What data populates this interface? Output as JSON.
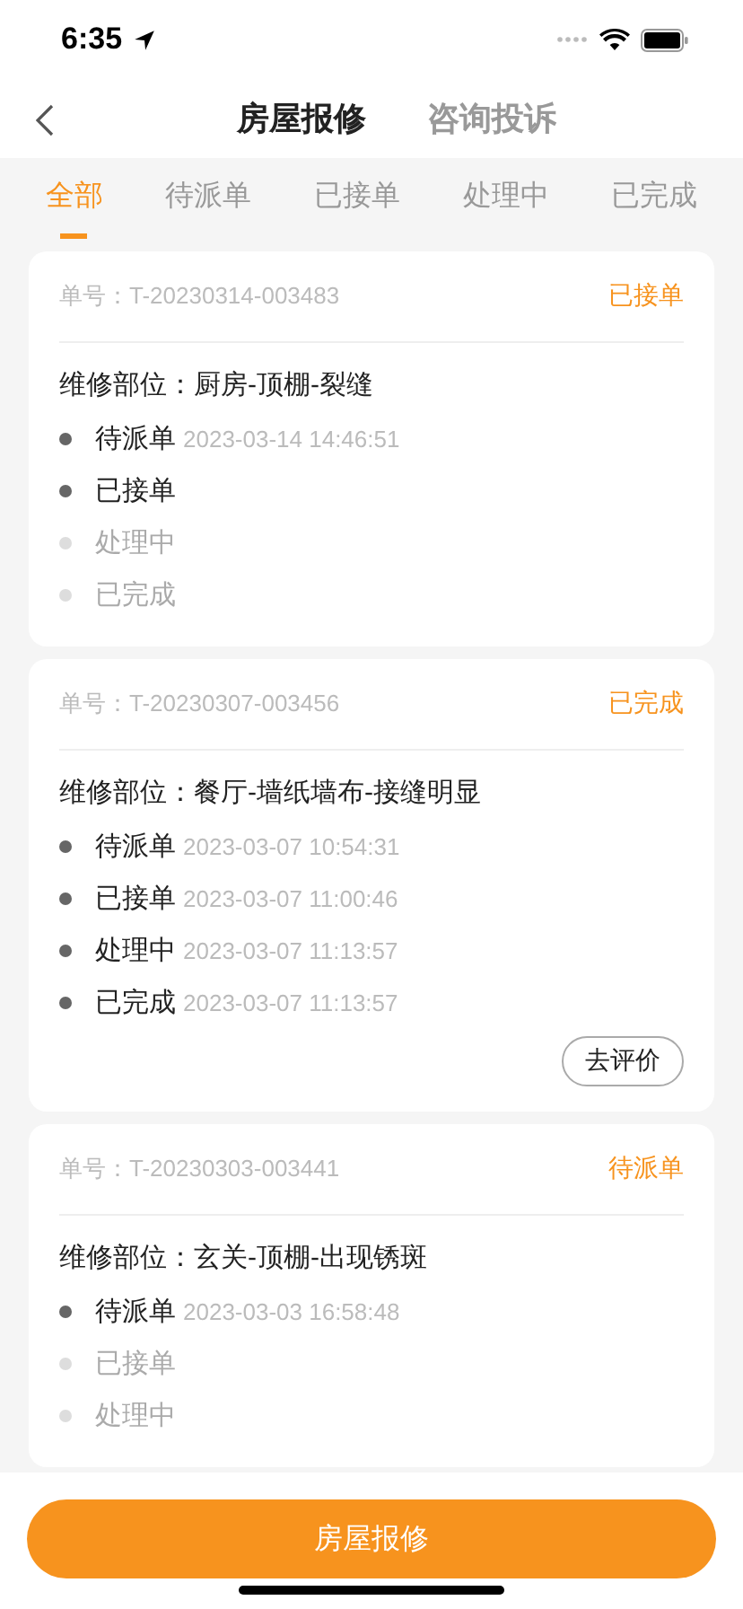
{
  "status_bar": {
    "time": "6:35"
  },
  "nav": {
    "tabs": [
      {
        "label": "房屋报修",
        "selected": true
      },
      {
        "label": "咨询投诉",
        "selected": false
      }
    ]
  },
  "filter_tabs": [
    {
      "label": "全部",
      "selected": true
    },
    {
      "label": "待派单",
      "selected": false
    },
    {
      "label": "已接单",
      "selected": false
    },
    {
      "label": "处理中",
      "selected": false
    },
    {
      "label": "已完成",
      "selected": false
    }
  ],
  "orders": [
    {
      "number": "单号：T-20230314-003483",
      "status": "已接单",
      "location": "维修部位：厨房-顶棚-裂缝",
      "steps": [
        {
          "label": "待派单",
          "done": true,
          "time": "2023-03-14 14:46:51"
        },
        {
          "label": "已接单",
          "done": true
        },
        {
          "label": "处理中",
          "done": false
        },
        {
          "label": "已完成",
          "done": false
        }
      ]
    },
    {
      "number": "单号：T-20230307-003456",
      "status": "已完成",
      "location": "维修部位：餐厅-墙纸墙布-接缝明显",
      "steps": [
        {
          "label": "待派单",
          "done": true,
          "time": "2023-03-07 10:54:31"
        },
        {
          "label": "已接单",
          "done": true,
          "time": "2023-03-07 11:00:46"
        },
        {
          "label": "处理中",
          "done": true,
          "time": "2023-03-07 11:13:57"
        },
        {
          "label": "已完成",
          "done": true,
          "time": "2023-03-07 11:13:57"
        }
      ],
      "action": "去评价"
    },
    {
      "number": "单号：T-20230303-003441",
      "status": "待派单",
      "location": "维修部位：玄关-顶棚-出现锈斑",
      "steps": [
        {
          "label": "待派单",
          "done": true,
          "time": "2023-03-03 16:58:48"
        },
        {
          "label": "已接单",
          "done": false
        },
        {
          "label": "处理中",
          "done": false
        }
      ]
    }
  ],
  "bottom_button": "房屋报修"
}
